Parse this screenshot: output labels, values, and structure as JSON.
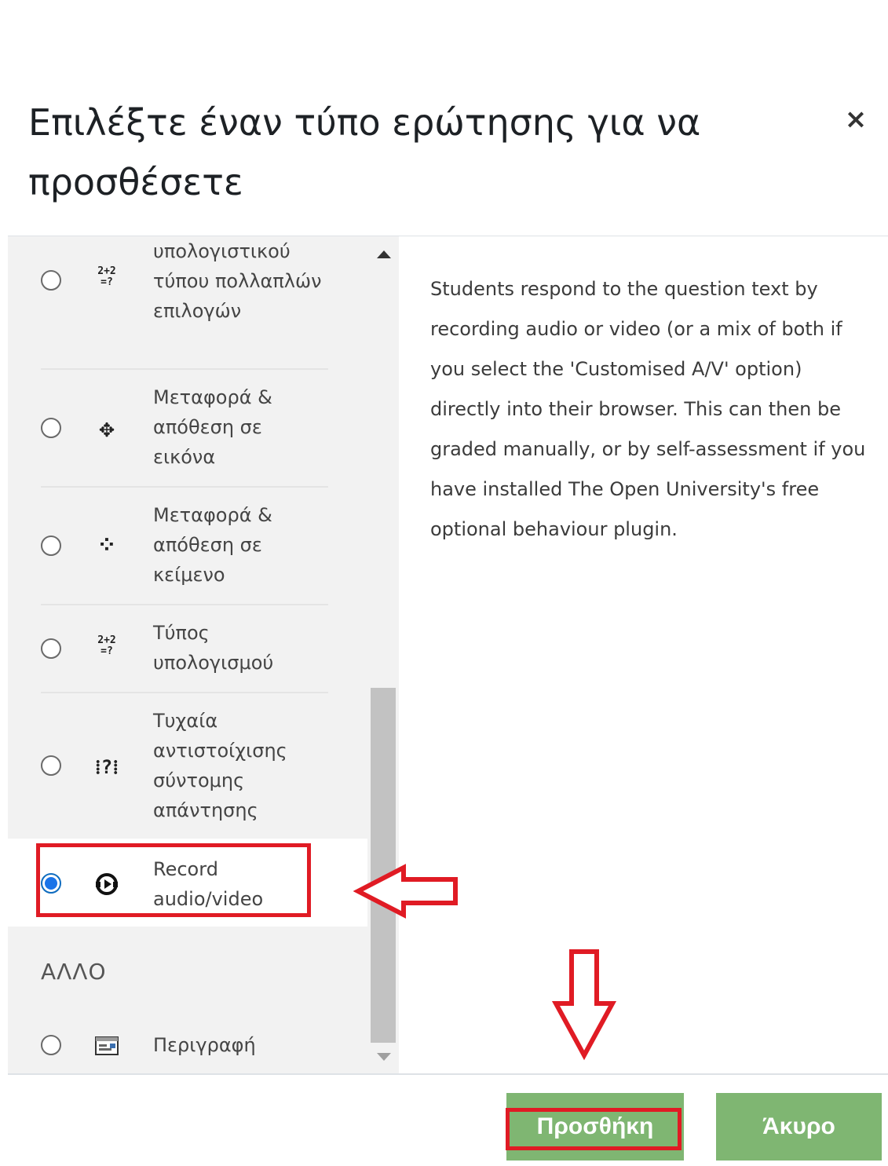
{
  "dialog": {
    "title": "Επιλέξτε έναν τύπο ερώτησης για να προσθέσετε",
    "close_label": "×"
  },
  "question_types": [
    {
      "label": "υπολογιστικού τύπου πολλαπλών επιλογών",
      "icon": "calculated-multichoice-icon",
      "icon_text": "2+2 =?",
      "checked": false
    },
    {
      "label": "Μεταφορά & απόθεση σε εικόνα",
      "icon": "drag-drop-image-icon",
      "icon_text": "✥",
      "checked": false
    },
    {
      "label": "Μεταφορά & απόθεση σε κείμενο",
      "icon": "drag-drop-text-icon",
      "icon_text": "⁘",
      "checked": false
    },
    {
      "label": "Τύπος υπολογισμού",
      "icon": "calculated-icon",
      "icon_text": "2+2 =?",
      "checked": false
    },
    {
      "label": "Τυχαία αντιστοίχισης σύντομης απάντησης",
      "icon": "random-short-answer-matching-icon",
      "icon_text": "⁞?⁞",
      "checked": false
    },
    {
      "label": "Record audio/video",
      "icon": "record-audio-video-icon",
      "icon_text": "◐",
      "checked": true
    }
  ],
  "other_section": {
    "heading": "ΑΛΛΟ",
    "items": [
      {
        "label": "Περιγραφή",
        "icon": "description-icon",
        "checked": false
      }
    ]
  },
  "description": "Students respond to the question text by recording audio or video (or a mix of both if you select the 'Customised A/V' option) directly into their browser. This can then be graded manually, or by self-assessment if you have installed The Open University's free optional behaviour plugin.",
  "footer": {
    "add_label": "Προσθήκη",
    "cancel_label": "Άκυρο"
  },
  "colors": {
    "button_green": "#7fb672",
    "highlight_red": "#e01b24",
    "radio_blue": "#1a73e8"
  }
}
